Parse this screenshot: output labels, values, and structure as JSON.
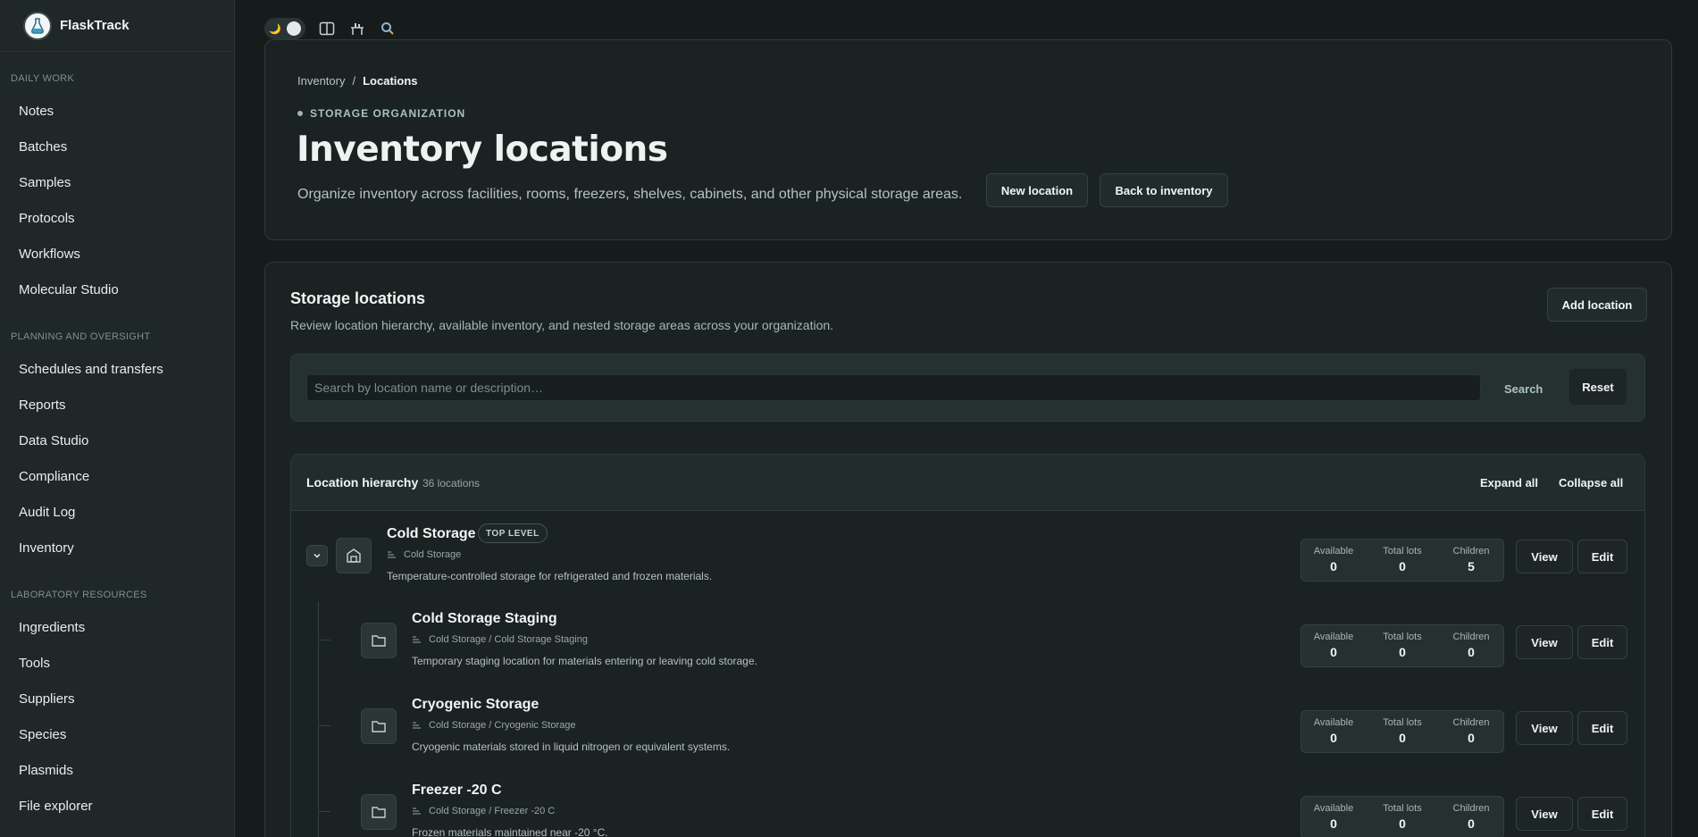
{
  "app": {
    "name": "FlaskTrack"
  },
  "sidebar": {
    "sections": [
      {
        "title": "DAILY WORK",
        "items": [
          "Notes",
          "Batches",
          "Samples",
          "Protocols",
          "Workflows",
          "Molecular Studio"
        ]
      },
      {
        "title": "PLANNING AND OVERSIGHT",
        "items": [
          "Schedules and transfers",
          "Reports",
          "Data Studio",
          "Compliance",
          "Audit Log",
          "Inventory"
        ]
      },
      {
        "title": "LABORATORY RESOURCES",
        "items": [
          "Ingredients",
          "Tools",
          "Suppliers",
          "Species",
          "Plasmids",
          "File explorer"
        ]
      }
    ]
  },
  "toolbar": {
    "icons": [
      "theme-toggle",
      "split-view-icon",
      "lab-bench-icon",
      "search-icon"
    ]
  },
  "hero": {
    "breadcrumb": {
      "parent": "Inventory",
      "separator": "/",
      "current": "Locations"
    },
    "eyebrow": "STORAGE ORGANIZATION",
    "title": "Inventory locations",
    "description": "Organize inventory across facilities, rooms, freezers, shelves, cabinets, and other physical storage areas.",
    "new_location": "New location",
    "back_to_inventory": "Back to inventory"
  },
  "storage": {
    "title": "Storage locations",
    "description": "Review location hierarchy, available inventory, and nested storage areas across your organization.",
    "add_location": "Add location",
    "search_placeholder": "Search by location name or description…",
    "search": "Search",
    "reset": "Reset"
  },
  "hierarchy": {
    "title": "Location hierarchy",
    "count": "36 locations",
    "expand_all": "Expand all",
    "collapse_all": "Collapse all",
    "stat_labels": {
      "available": "Available",
      "total_lots": "Total lots",
      "children": "Children"
    },
    "view": "View",
    "edit": "Edit",
    "rows": [
      {
        "name": "Cold Storage",
        "badge": "TOP LEVEL",
        "path": "Cold Storage",
        "description": "Temperature-controlled storage for refrigerated and frozen materials.",
        "available": "0",
        "total_lots": "0",
        "children": "5"
      },
      {
        "name": "Cold Storage Staging",
        "path": "Cold Storage / Cold Storage Staging",
        "description": "Temporary staging location for materials entering or leaving cold storage.",
        "available": "0",
        "total_lots": "0",
        "children": "0"
      },
      {
        "name": "Cryogenic Storage",
        "path": "Cold Storage / Cryogenic Storage",
        "description": "Cryogenic materials stored in liquid nitrogen or equivalent systems.",
        "available": "0",
        "total_lots": "0",
        "children": "0"
      },
      {
        "name": "Freezer -20 C",
        "path": "Cold Storage / Freezer -20 C",
        "description": "Frozen materials maintained near -20 °C.",
        "available": "0",
        "total_lots": "0",
        "children": "0"
      }
    ]
  },
  "colors": {
    "background": "#161c1c",
    "sidebar": "#1f2727",
    "card": "#1b2222",
    "accent": "#a9c4bf"
  }
}
